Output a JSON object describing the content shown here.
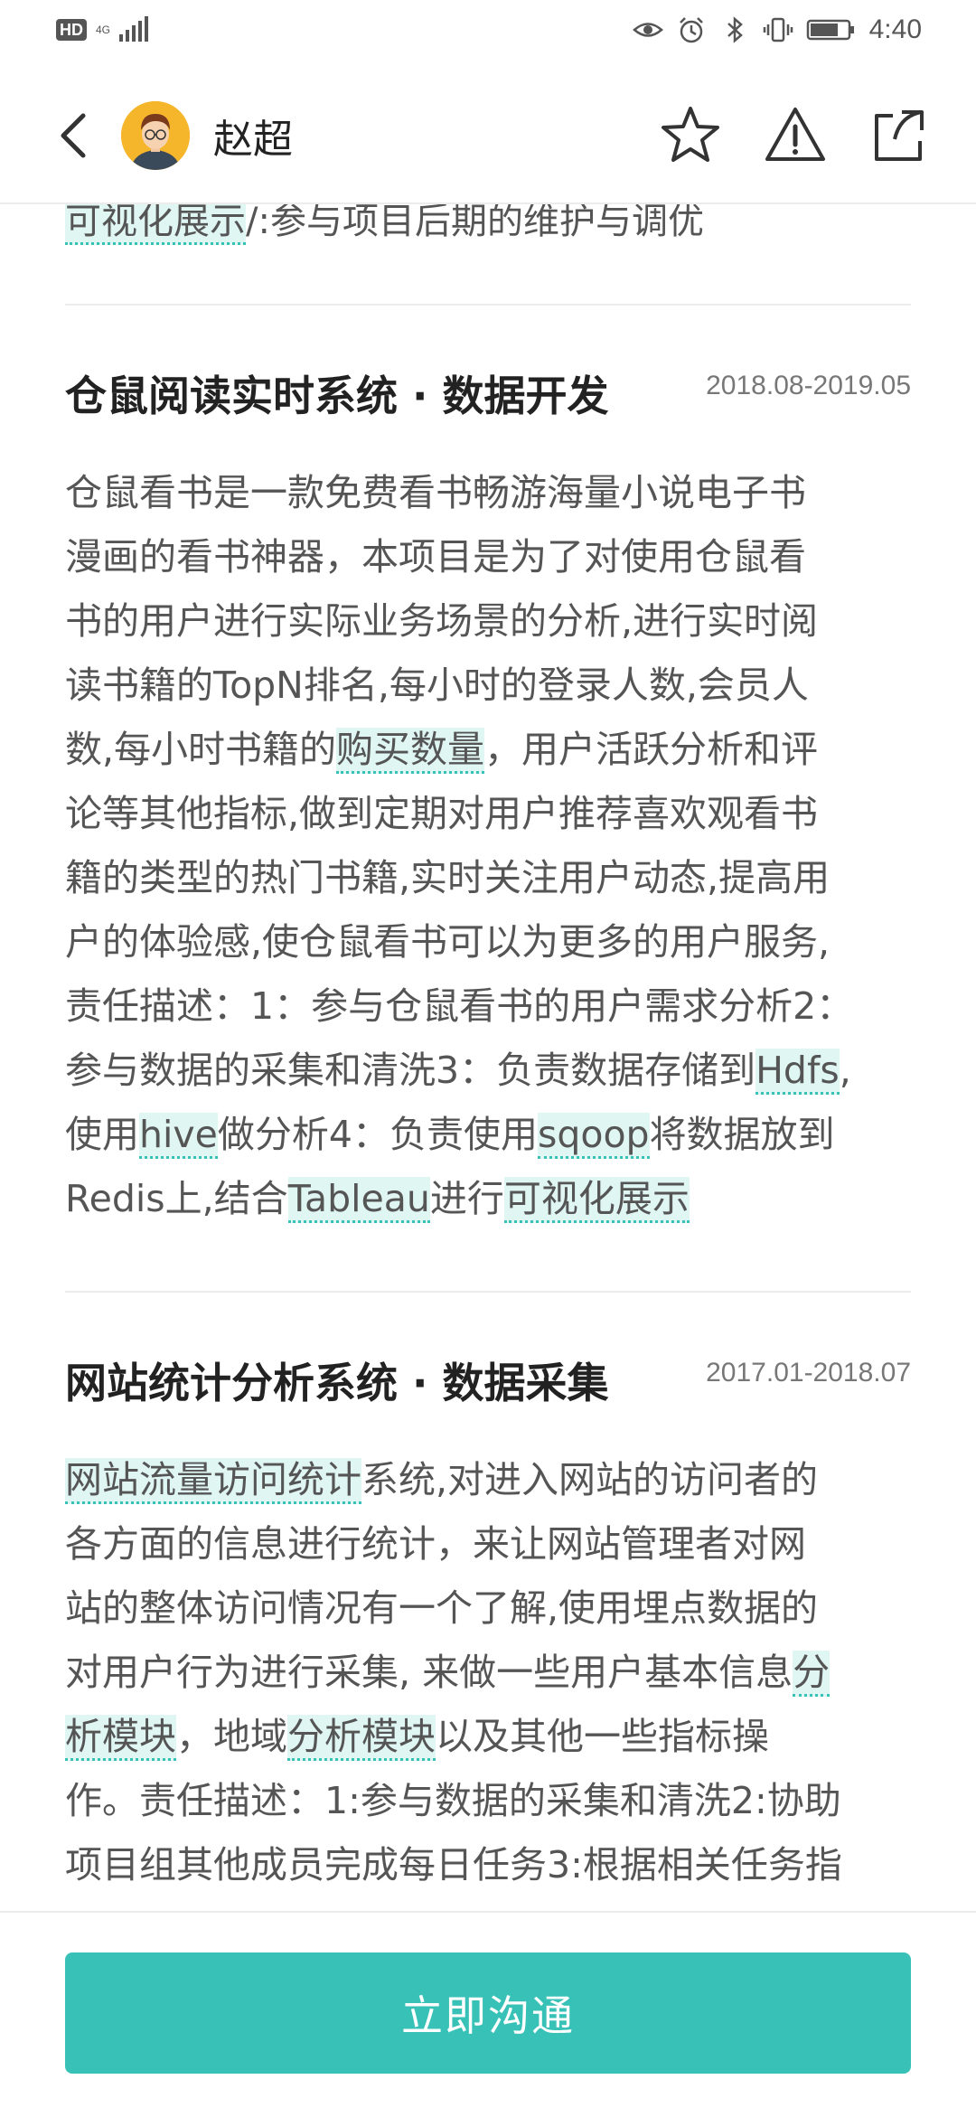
{
  "status_bar": {
    "hd": "HD",
    "network": "4G",
    "time": "4:40",
    "icons": [
      "eye-icon",
      "alarm-icon",
      "bluetooth-icon",
      "vibrate-icon",
      "battery-icon"
    ]
  },
  "header": {
    "name": "赵超",
    "icons": [
      "back-arrow-icon",
      "star-icon",
      "warning-icon",
      "share-icon"
    ]
  },
  "content": {
    "cut_prev": {
      "segments": [
        {
          "text": "可视化展示",
          "kw": true
        },
        {
          "text": "/:参与项目后期的维护与调优",
          "kw": false
        }
      ]
    },
    "projects": [
      {
        "title": "仓鼠阅读实时系统 · 数据开发",
        "date": "2018.08-2019.05",
        "lines": [
          [
            {
              "text": "仓鼠看书是一款免费看书畅游海量小说电子书",
              "kw": false
            }
          ],
          [
            {
              "text": "漫画的看书神器，本项目是为了对使用仓鼠看",
              "kw": false
            }
          ],
          [
            {
              "text": "书的用户进行实际业务场景的分析,进行实时阅",
              "kw": false
            }
          ],
          [
            {
              "text": "读书籍的TopN排名,每小时的登录人数,会员人",
              "kw": false
            }
          ],
          [
            {
              "text": "数,每小时书籍的",
              "kw": false
            },
            {
              "text": "购买数量",
              "kw": true
            },
            {
              "text": "，用户活跃分析和评",
              "kw": false
            }
          ],
          [
            {
              "text": "论等其他指标,做到定期对用户推荐喜欢观看书",
              "kw": false
            }
          ],
          [
            {
              "text": "籍的类型的热门书籍,实时关注用户动态,提高用",
              "kw": false
            }
          ],
          [
            {
              "text": "户的体验感,使仓鼠看书可以为更多的用户服务,",
              "kw": false
            }
          ],
          [
            {
              "text": "责任描述：1：参与仓鼠看书的用户需求分析2：",
              "kw": false
            }
          ],
          [
            {
              "text": "参与数据的采集和清洗3：负责数据存储到",
              "kw": false
            },
            {
              "text": "Hdfs",
              "kw": true
            },
            {
              "text": ",",
              "kw": false
            }
          ],
          [
            {
              "text": "使用",
              "kw": false
            },
            {
              "text": "hive",
              "kw": true
            },
            {
              "text": "做分析4：负责使用",
              "kw": false
            },
            {
              "text": "sqoop",
              "kw": true
            },
            {
              "text": "将数据放到",
              "kw": false
            }
          ],
          [
            {
              "text": "Redis上,结合",
              "kw": false
            },
            {
              "text": "Tableau",
              "kw": true
            },
            {
              "text": "进行",
              "kw": false
            },
            {
              "text": "可视化展示",
              "kw": true
            }
          ]
        ]
      },
      {
        "title": "网站统计分析系统 · 数据采集",
        "date": "2017.01-2018.07",
        "lines": [
          [
            {
              "text": "网站流量访问统计",
              "kw": true
            },
            {
              "text": "系统,对进入网站的访问者的",
              "kw": false
            }
          ],
          [
            {
              "text": "各方面的信息进行统计，来让网站管理者对网",
              "kw": false
            }
          ],
          [
            {
              "text": "站的整体访问情况有一个了解,使用埋点数据的",
              "kw": false
            }
          ],
          [
            {
              "text": "对用户行为进行采集, 来做一些用户基本信息",
              "kw": false
            },
            {
              "text": "分",
              "kw": true
            }
          ],
          [
            {
              "text": "析模块",
              "kw": true
            },
            {
              "text": "，地域",
              "kw": false
            },
            {
              "text": "分析模块",
              "kw": true
            },
            {
              "text": "以及其他一些指标操",
              "kw": false
            }
          ],
          [
            {
              "text": "作。责任描述：1:参与数据的采集和清洗2:协助",
              "kw": false
            }
          ],
          [
            {
              "text": "项目组其他成员完成每日任务3:根据相关任务指",
              "kw": false
            }
          ]
        ]
      }
    ]
  },
  "bottom": {
    "chat_button": "立即沟通"
  },
  "colors": {
    "accent": "#38c2b7",
    "keyword_bg": "#dff6f2",
    "avatar_bg": "#f6b62b"
  }
}
